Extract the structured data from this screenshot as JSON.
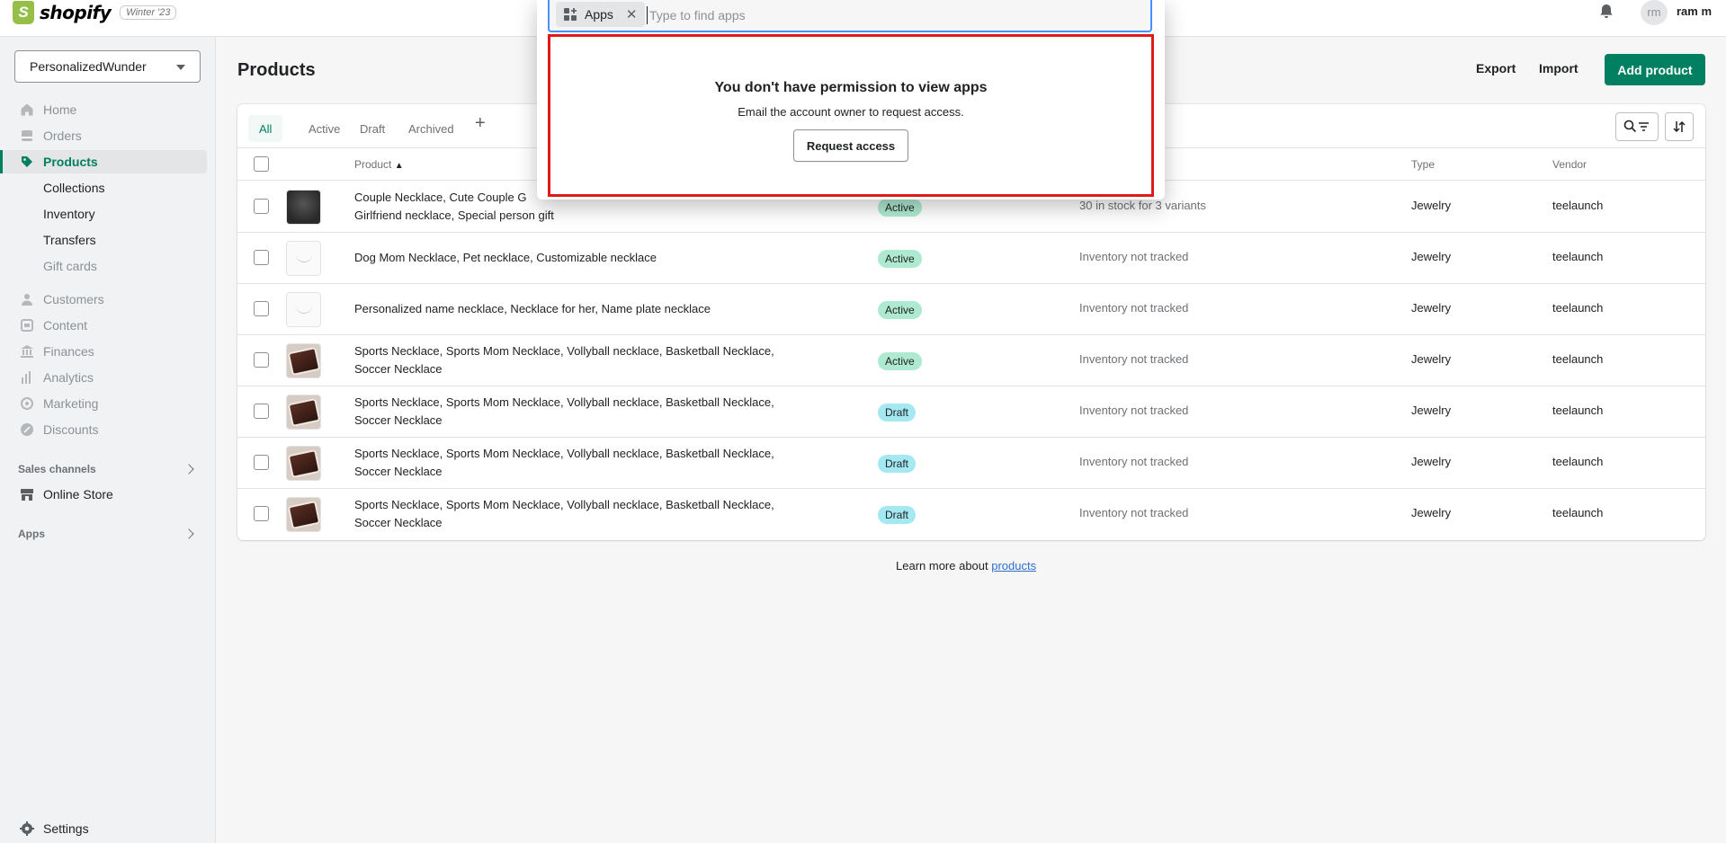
{
  "topbar": {
    "logo_glyph": "S",
    "brand": "shopify",
    "edition_badge": "Winter '23",
    "avatar_initials": "rm",
    "username": "ram m"
  },
  "sidebar": {
    "store_name": "PersonalizedWunder",
    "nav": [
      {
        "label": "Home",
        "icon": "home-icon"
      },
      {
        "label": "Orders",
        "icon": "orders-icon"
      },
      {
        "label": "Products",
        "icon": "tag-icon",
        "active": true
      },
      {
        "label": "Collections"
      },
      {
        "label": "Inventory"
      },
      {
        "label": "Transfers"
      },
      {
        "label": "Gift cards"
      },
      {
        "label": "Customers",
        "icon": "person-icon"
      },
      {
        "label": "Content",
        "icon": "content-icon"
      },
      {
        "label": "Finances",
        "icon": "bank-icon"
      },
      {
        "label": "Analytics",
        "icon": "analytics-icon"
      },
      {
        "label": "Marketing",
        "icon": "marketing-icon"
      },
      {
        "label": "Discounts",
        "icon": "discount-icon"
      }
    ],
    "sales_channels_label": "Sales channels",
    "online_store_label": "Online Store",
    "apps_label": "Apps",
    "settings_label": "Settings"
  },
  "header": {
    "title": "Products",
    "export_label": "Export",
    "import_label": "Import",
    "add_product_label": "Add product"
  },
  "tabs": [
    {
      "label": "All",
      "selected": true
    },
    {
      "label": "Active"
    },
    {
      "label": "Draft"
    },
    {
      "label": "Archived"
    }
  ],
  "tab_add": "+",
  "table": {
    "columns": {
      "product": "Product",
      "type": "Type",
      "vendor": "Vendor"
    },
    "rows": [
      {
        "line1": "Couple Necklace, Cute Couple G",
        "line2": "Girlfriend necklace, Special person gift",
        "status": "Active",
        "inventory": "30 in stock for 3 variants",
        "type": "Jewelry",
        "vendor": "teelaunch",
        "thumb": "dark"
      },
      {
        "line1": "Dog Mom Necklace, Pet necklace, Customizable necklace",
        "line2": "",
        "status": "Active",
        "inventory": "Inventory not tracked",
        "type": "Jewelry",
        "vendor": "teelaunch",
        "thumb": "light"
      },
      {
        "line1": "Personalized name necklace, Necklace for her, Name plate necklace",
        "line2": "",
        "status": "Active",
        "inventory": "Inventory not tracked",
        "type": "Jewelry",
        "vendor": "teelaunch",
        "thumb": "light"
      },
      {
        "line1": "Sports Necklace, Sports Mom Necklace, Vollyball necklace, Basketball Necklace,",
        "line2": "Soccer Necklace",
        "status": "Active",
        "inventory": "Inventory not tracked",
        "type": "Jewelry",
        "vendor": "teelaunch",
        "thumb": "box"
      },
      {
        "line1": "Sports Necklace, Sports Mom Necklace, Vollyball necklace, Basketball Necklace,",
        "line2": "Soccer Necklace",
        "status": "Draft",
        "inventory": "Inventory not tracked",
        "type": "Jewelry",
        "vendor": "teelaunch",
        "thumb": "box"
      },
      {
        "line1": "Sports Necklace, Sports Mom Necklace, Vollyball necklace, Basketball Necklace,",
        "line2": "Soccer Necklace",
        "status": "Draft",
        "inventory": "Inventory not tracked",
        "type": "Jewelry",
        "vendor": "teelaunch",
        "thumb": "box"
      },
      {
        "line1": "Sports Necklace, Sports Mom Necklace, Vollyball necklace, Basketball Necklace,",
        "line2": "Soccer Necklace",
        "status": "Draft",
        "inventory": "Inventory not tracked",
        "type": "Jewelry",
        "vendor": "teelaunch",
        "thumb": "box"
      }
    ]
  },
  "footer": {
    "learn_prefix": "Learn more about ",
    "learn_link": "products"
  },
  "search": {
    "chip_label": "Apps",
    "chip_close": "✕",
    "placeholder": "Type to find apps",
    "permission_title": "You don't have permission to view apps",
    "permission_subtitle": "Email the account owner to request access.",
    "request_button": "Request access"
  },
  "colors": {
    "brand_green": "#008060",
    "active_badge": "#aee9d1",
    "draft_badge": "#a4e8f2",
    "highlight_border": "#e01a1a",
    "focus_blue": "#458fff"
  }
}
